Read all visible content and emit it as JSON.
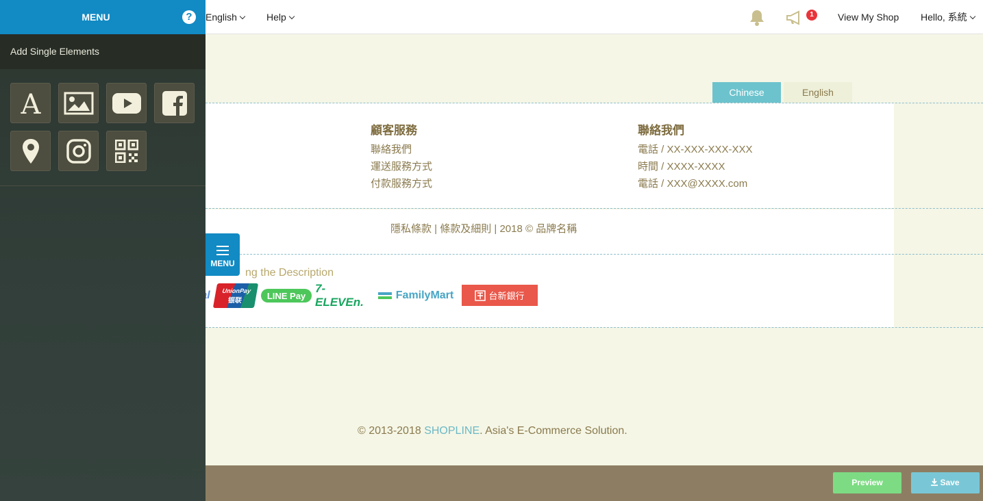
{
  "topbar": {
    "language": "English",
    "help": "Help",
    "notification_count": "1",
    "view_shop": "View My Shop",
    "greeting": "Hello, 系統"
  },
  "content": {
    "lang_tabs": {
      "active": "Chinese",
      "inactive": "English"
    },
    "customer_service": {
      "title": "顧客服務",
      "links": [
        "聯絡我們",
        "運送服務方式",
        "付款服務方式"
      ]
    },
    "contact": {
      "title": "聯絡我們",
      "lines": [
        "電話 / XX-XXX-XXX-XXX",
        "時間 / XXXX-XXXX",
        "電話 / XXX@XXXX.com"
      ]
    },
    "legal": "隱私條款 | 條款及細則 | 2018 © 品牌名稱",
    "description": "ng the Description",
    "payment_logos": {
      "partial": "al",
      "unionpay": "UnionPay",
      "unionpay_cn": "银联",
      "linepay": "LINE Pay",
      "seven": "7-ELEVEn.",
      "familymart": "FamilyMart",
      "taishin": "台新銀行"
    },
    "copyright_prefix": "© 2013-2018 ",
    "copyright_brand": "SHOPLINE",
    "copyright_suffix": ". Asia's E-Commerce Solution."
  },
  "bottombar": {
    "preview": "Preview",
    "save": "Save"
  },
  "sidebar": {
    "title": "MENU",
    "help_icon": "?",
    "section": "Add Single Elements",
    "tiles": [
      {
        "name": "text-element",
        "icon": "text-icon"
      },
      {
        "name": "image-element",
        "icon": "image-icon"
      },
      {
        "name": "youtube-element",
        "icon": "youtube-icon"
      },
      {
        "name": "facebook-element",
        "icon": "facebook-icon"
      },
      {
        "name": "map-element",
        "icon": "map-pin-icon"
      },
      {
        "name": "instagram-element",
        "icon": "instagram-icon"
      },
      {
        "name": "qrcode-element",
        "icon": "qr-code-icon"
      }
    ],
    "toggle_label": "MENU"
  },
  "colors": {
    "menu_blue": "#128ac3",
    "tab_teal": "#6cc3cd",
    "preview_green": "#7ddc83",
    "save_teal": "#79c7d6",
    "badge_red": "#e8353b"
  }
}
